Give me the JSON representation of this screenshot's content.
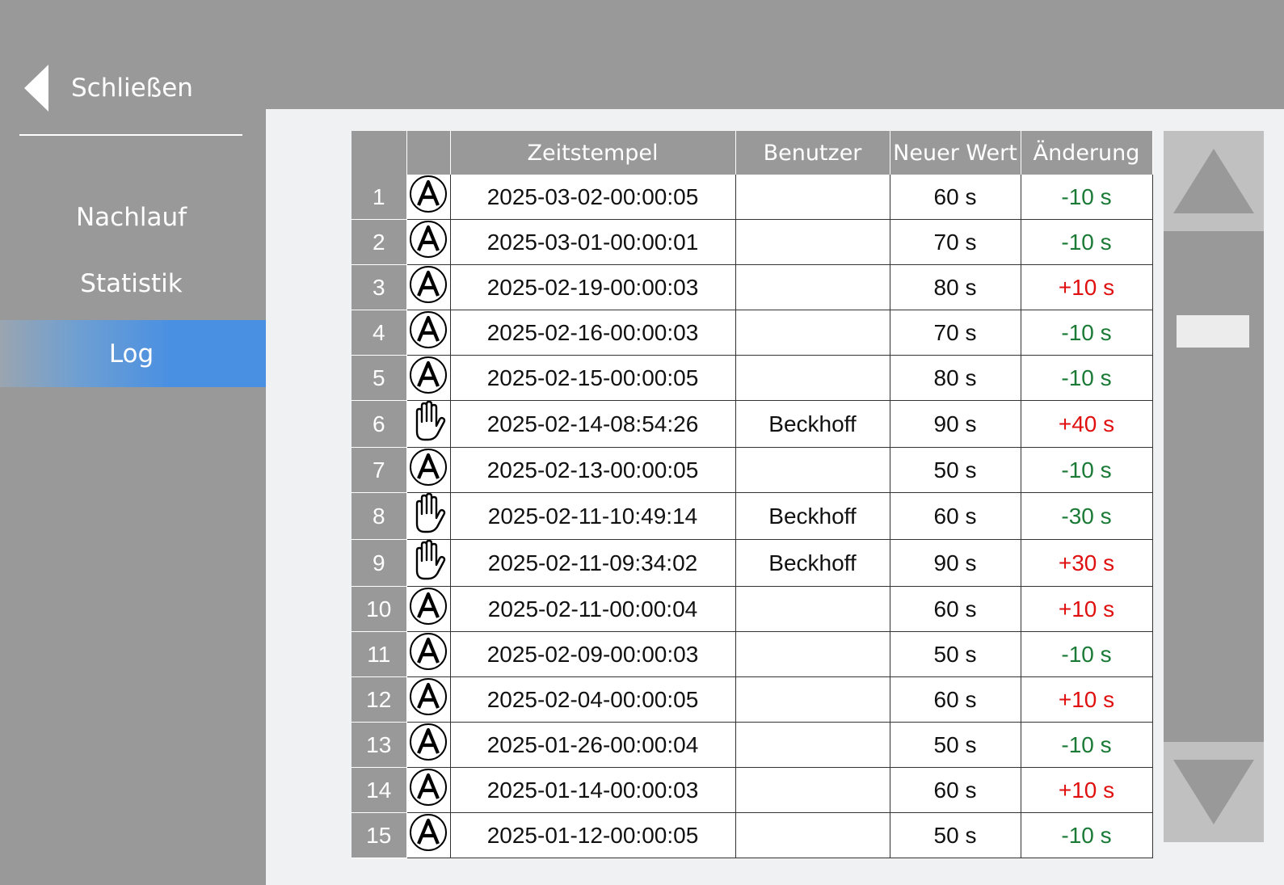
{
  "close": {
    "label": "Schließen"
  },
  "nav": {
    "items": [
      {
        "label": "Nachlauf"
      },
      {
        "label": "Statistik"
      },
      {
        "label": "Log"
      }
    ],
    "active": "Log"
  },
  "table": {
    "headers": [
      "",
      "",
      "Zeitstempel",
      "Benutzer",
      "Neuer Wert",
      "Änderung"
    ],
    "rows": [
      {
        "nr": "1",
        "mode": "auto-icon",
        "timestamp": "2025-03-02-00:00:05",
        "user": "",
        "value": "60 s",
        "change": "-10 s",
        "sign": "neg"
      },
      {
        "nr": "2",
        "mode": "auto-icon",
        "timestamp": "2025-03-01-00:00:01",
        "user": "",
        "value": "70 s",
        "change": "-10 s",
        "sign": "neg"
      },
      {
        "nr": "3",
        "mode": "auto-icon",
        "timestamp": "2025-02-19-00:00:03",
        "user": "",
        "value": "80 s",
        "change": "+10 s",
        "sign": "pos"
      },
      {
        "nr": "4",
        "mode": "auto-icon",
        "timestamp": "2025-02-16-00:00:03",
        "user": "",
        "value": "70 s",
        "change": "-10 s",
        "sign": "neg"
      },
      {
        "nr": "5",
        "mode": "auto-icon",
        "timestamp": "2025-02-15-00:00:05",
        "user": "",
        "value": "80 s",
        "change": "-10 s",
        "sign": "neg"
      },
      {
        "nr": "6",
        "mode": "manual-icon",
        "timestamp": "2025-02-14-08:54:26",
        "user": "Beckhoff",
        "value": "90 s",
        "change": "+40 s",
        "sign": "pos"
      },
      {
        "nr": "7",
        "mode": "auto-icon",
        "timestamp": "2025-02-13-00:00:05",
        "user": "",
        "value": "50 s",
        "change": "-10 s",
        "sign": "neg"
      },
      {
        "nr": "8",
        "mode": "manual-icon",
        "timestamp": "2025-02-11-10:49:14",
        "user": "Beckhoff",
        "value": "60 s",
        "change": "-30 s",
        "sign": "neg"
      },
      {
        "nr": "9",
        "mode": "manual-icon",
        "timestamp": "2025-02-11-09:34:02",
        "user": "Beckhoff",
        "value": "90 s",
        "change": "+30 s",
        "sign": "pos"
      },
      {
        "nr": "10",
        "mode": "auto-icon",
        "timestamp": "2025-02-11-00:00:04",
        "user": "",
        "value": "60 s",
        "change": "+10 s",
        "sign": "pos"
      },
      {
        "nr": "11",
        "mode": "auto-icon",
        "timestamp": "2025-02-09-00:00:03",
        "user": "",
        "value": "50 s",
        "change": "-10 s",
        "sign": "neg"
      },
      {
        "nr": "12",
        "mode": "auto-icon",
        "timestamp": "2025-02-04-00:00:05",
        "user": "",
        "value": "60 s",
        "change": "+10 s",
        "sign": "pos"
      },
      {
        "nr": "13",
        "mode": "auto-icon",
        "timestamp": "2025-01-26-00:00:04",
        "user": "",
        "value": "50 s",
        "change": "-10 s",
        "sign": "neg"
      },
      {
        "nr": "14",
        "mode": "auto-icon",
        "timestamp": "2025-01-14-00:00:03",
        "user": "",
        "value": "60 s",
        "change": "+10 s",
        "sign": "pos"
      },
      {
        "nr": "15",
        "mode": "auto-icon",
        "timestamp": "2025-01-12-00:00:05",
        "user": "",
        "value": "50 s",
        "change": "-10 s",
        "sign": "neg"
      }
    ]
  },
  "colors": {
    "positive": "#e01010",
    "negative": "#1a7a36",
    "accent": "#4a90e2"
  }
}
